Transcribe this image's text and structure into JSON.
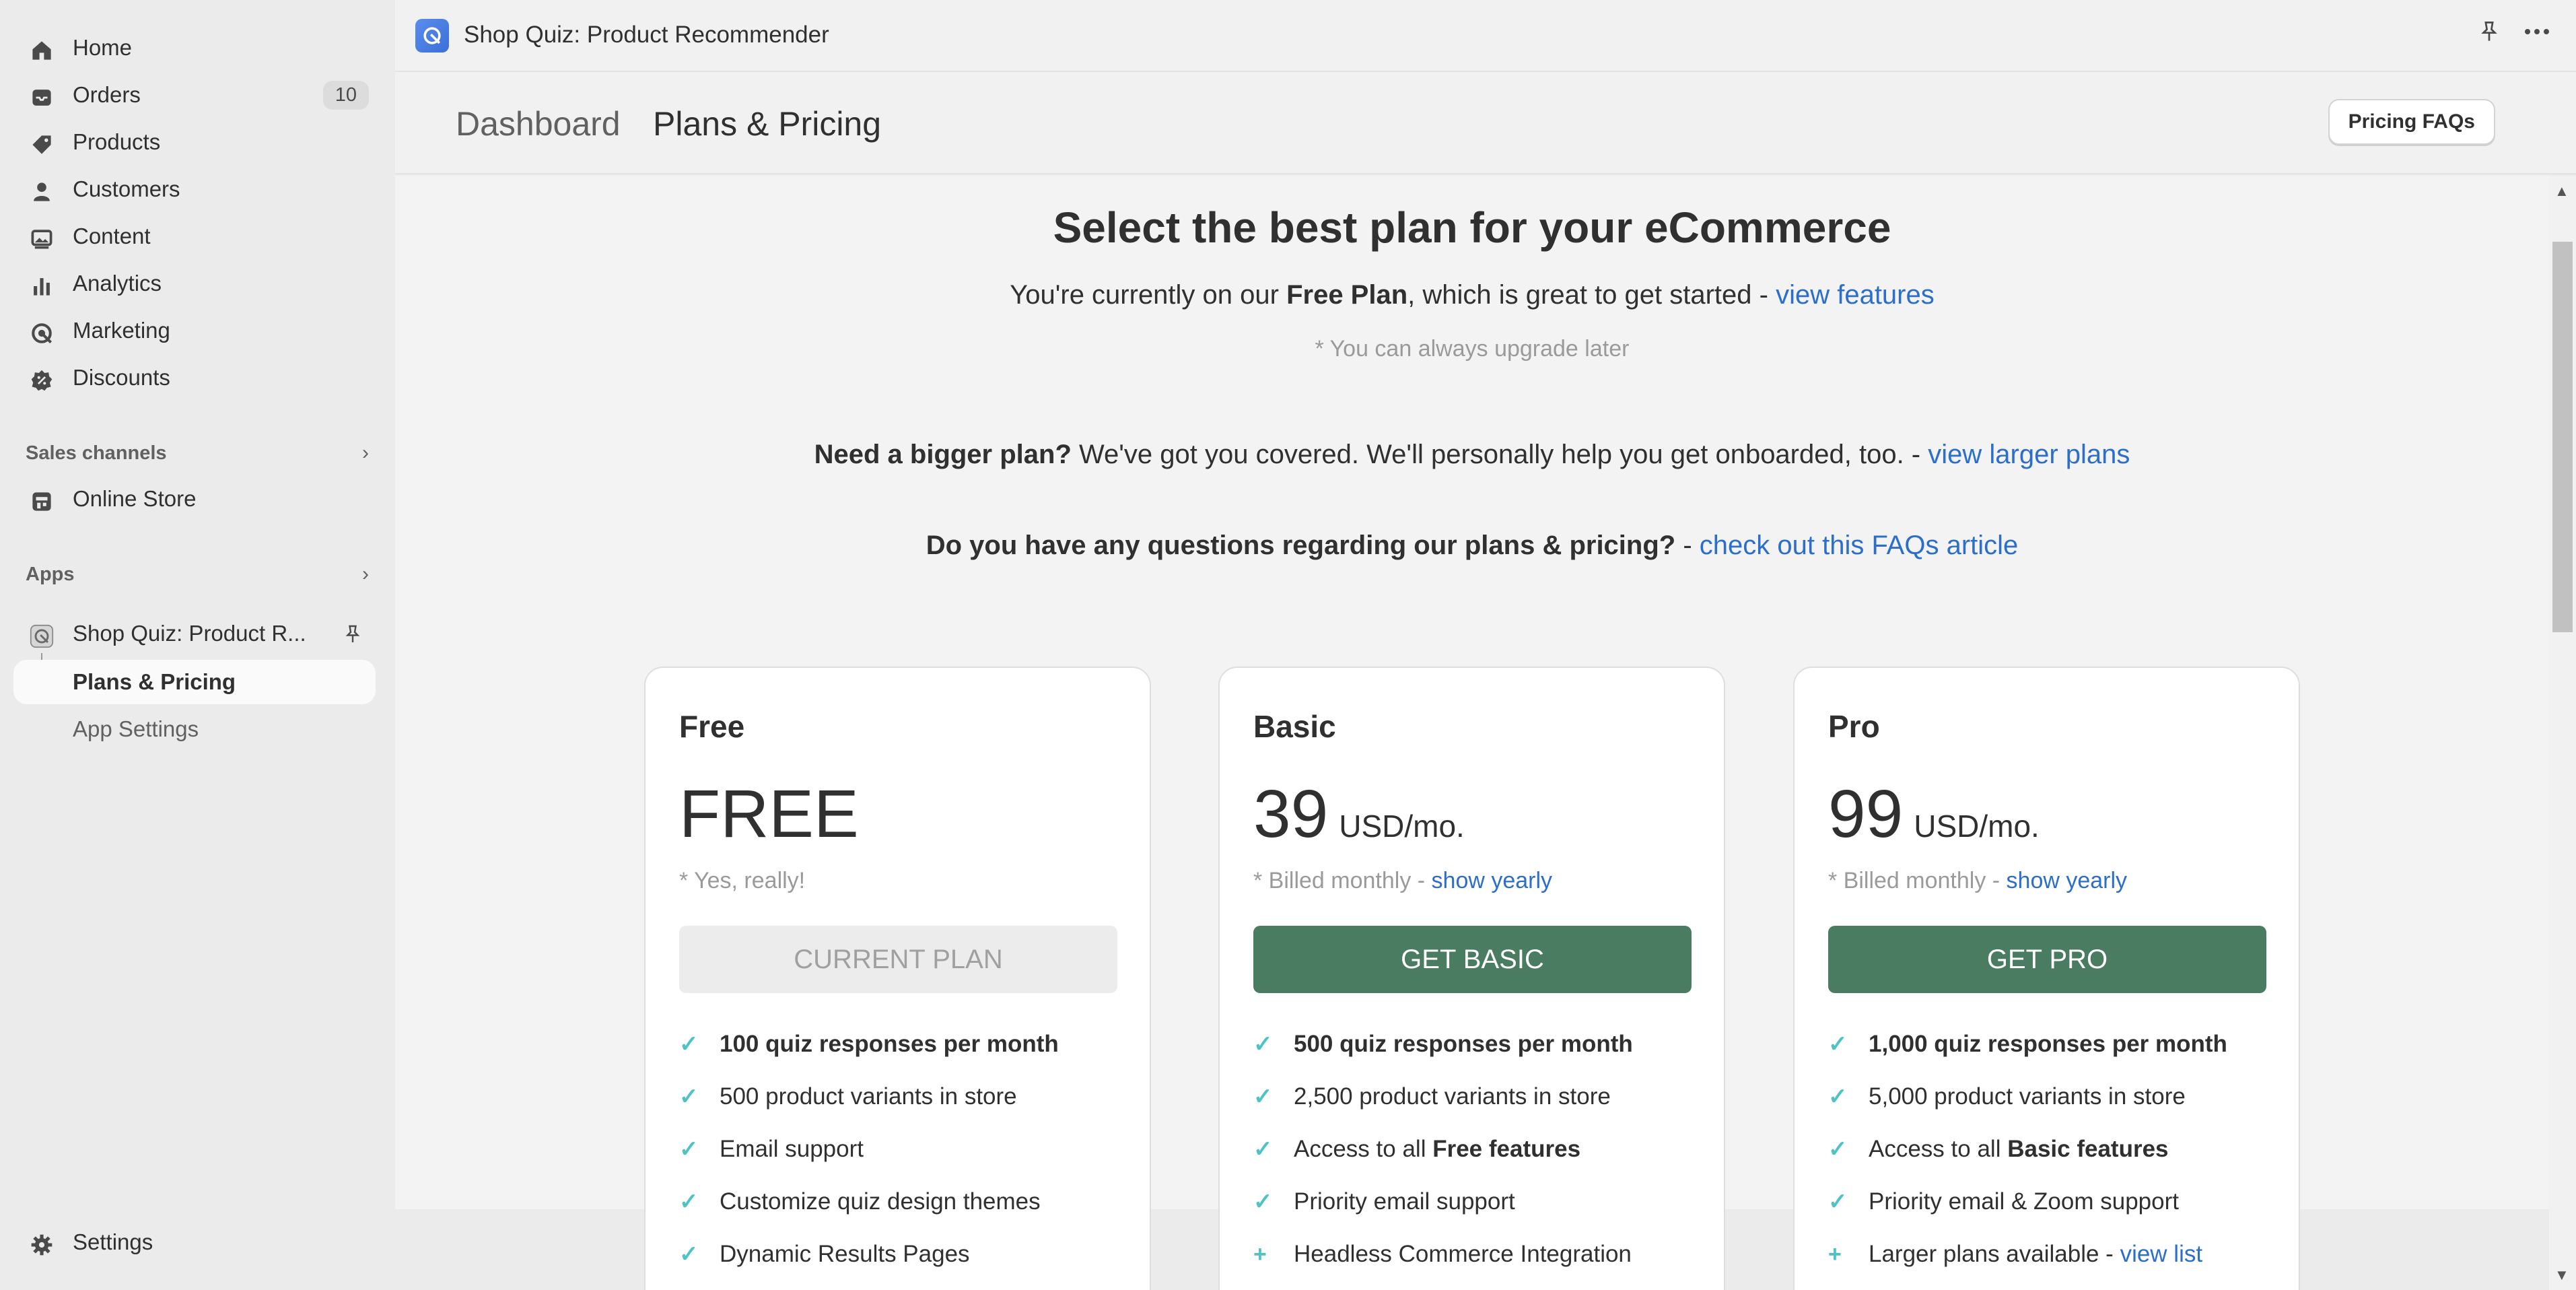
{
  "sidebar": {
    "nav": [
      {
        "label": "Home",
        "icon": "home-icon"
      },
      {
        "label": "Orders",
        "icon": "inbox-icon",
        "badge": "10"
      },
      {
        "label": "Products",
        "icon": "tag-icon"
      },
      {
        "label": "Customers",
        "icon": "person-icon"
      },
      {
        "label": "Content",
        "icon": "image-icon"
      },
      {
        "label": "Analytics",
        "icon": "bar-chart-icon"
      },
      {
        "label": "Marketing",
        "icon": "target-icon"
      },
      {
        "label": "Discounts",
        "icon": "discount-icon"
      }
    ],
    "sales_channels": {
      "heading": "Sales channels",
      "items": [
        {
          "label": "Online Store",
          "icon": "store-icon"
        }
      ]
    },
    "apps": {
      "heading": "Apps",
      "app": {
        "label": "Shop Quiz: Product R...",
        "icon": "app-icon"
      },
      "sub_items": [
        {
          "label": "Plans & Pricing",
          "active": true
        },
        {
          "label": "App Settings",
          "active": false
        }
      ]
    },
    "settings": {
      "label": "Settings",
      "icon": "gear-icon"
    }
  },
  "topbar": {
    "title": "Shop Quiz: Product Recommender"
  },
  "header": {
    "breadcrumb": "Dashboard",
    "title": "Plans & Pricing",
    "faq_button": "Pricing FAQs"
  },
  "main": {
    "heading": "Select the best plan for your eCommerce",
    "current_prefix": "You're currently on our ",
    "current_plan": "Free Plan",
    "current_suffix": ", which is great to get started - ",
    "current_link": "view features",
    "upgrade_note": "* You can always upgrade later",
    "bigger_bold": "Need a bigger plan?",
    "bigger_text": " We've got you covered. We'll personally help you get onboarded, too. - ",
    "bigger_link": "view larger plans",
    "questions_bold": "Do you have any questions regarding our plans & pricing?",
    "questions_text": " - ",
    "questions_link": "check out this FAQs article"
  },
  "plans": [
    {
      "name": "Free",
      "price": "FREE",
      "unit": "",
      "note": "* Yes, really!",
      "note_link": "",
      "cta": "CURRENT PLAN",
      "features": [
        {
          "mark": "check",
          "bold": "100 quiz responses per month",
          "text": ""
        },
        {
          "mark": "check",
          "bold": "",
          "text": "500 product variants in store"
        },
        {
          "mark": "check",
          "bold": "",
          "text": "Email support"
        },
        {
          "mark": "check",
          "bold": "",
          "text": "Customize quiz design themes"
        },
        {
          "mark": "check",
          "bold": "",
          "text": "Dynamic Results Pages"
        }
      ]
    },
    {
      "name": "Basic",
      "price": "39",
      "unit": "USD/mo.",
      "note": "* Billed monthly - ",
      "note_link": "show yearly",
      "cta": "GET BASIC",
      "features": [
        {
          "mark": "check",
          "bold": "500 quiz responses per month",
          "text": ""
        },
        {
          "mark": "check",
          "bold": "",
          "text": "2,500 product variants in store"
        },
        {
          "mark": "check",
          "prefix": "Access to all ",
          "bold": "Free features",
          "text": ""
        },
        {
          "mark": "check",
          "bold": "",
          "text": "Priority email support"
        },
        {
          "mark": "plus",
          "bold": "",
          "text": "Headless Commerce Integration"
        }
      ]
    },
    {
      "name": "Pro",
      "price": "99",
      "unit": "USD/mo.",
      "note": "* Billed monthly - ",
      "note_link": "show yearly",
      "cta": "GET PRO",
      "features": [
        {
          "mark": "check",
          "bold": "1,000 quiz responses per month",
          "text": ""
        },
        {
          "mark": "check",
          "bold": "",
          "text": "5,000 product variants in store"
        },
        {
          "mark": "check",
          "prefix": "Access to all ",
          "bold": "Basic features",
          "text": ""
        },
        {
          "mark": "check",
          "bold": "",
          "text": "Priority email & Zoom support"
        },
        {
          "mark": "plus",
          "bold": "",
          "text": "Larger plans available - ",
          "link": "view list"
        }
      ]
    }
  ],
  "colors": {
    "accent_green": "#4a7c62",
    "link_blue": "#2c6ecb",
    "check_teal": "#4ec3c5"
  }
}
